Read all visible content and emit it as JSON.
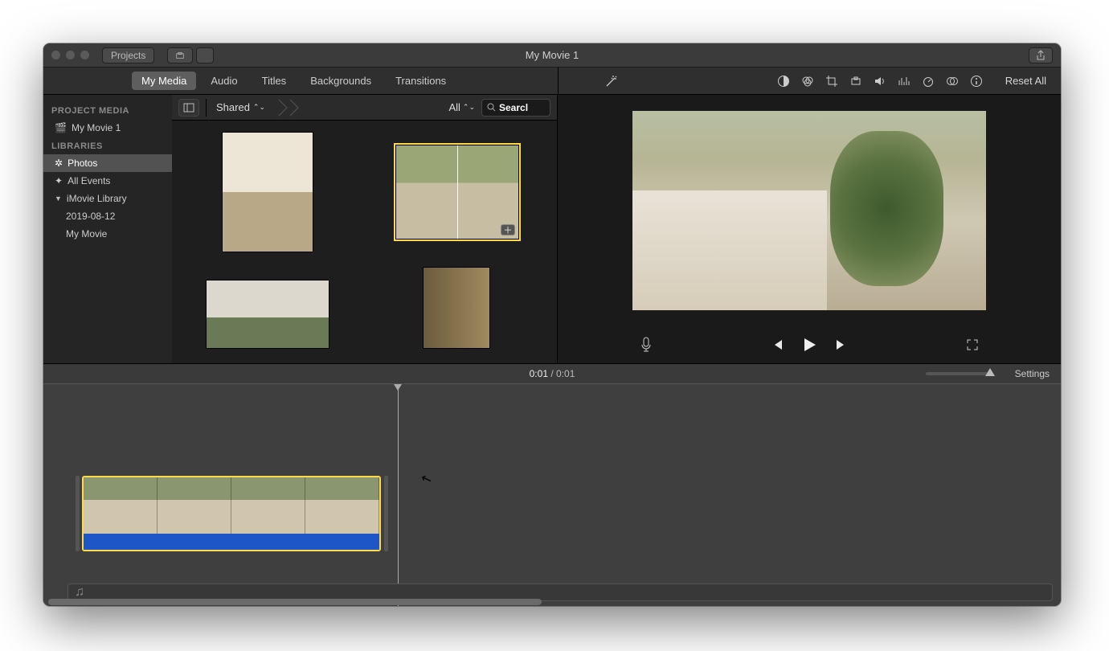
{
  "window_title": "My Movie 1",
  "toolbar": {
    "projects": "Projects"
  },
  "tabs": {
    "my_media": "My Media",
    "audio": "Audio",
    "titles": "Titles",
    "backgrounds": "Backgrounds",
    "transitions": "Transitions"
  },
  "viewer_controls": {
    "reset_all": "Reset All"
  },
  "sidebar": {
    "project_media_hdr": "PROJECT MEDIA",
    "movie_name": "My Movie 1",
    "libraries_hdr": "LIBRARIES",
    "photos": "Photos",
    "all_events": "All Events",
    "imovie_library": "iMovie Library",
    "event_date": "2019-08-12",
    "event_my_movie": "My Movie"
  },
  "browser": {
    "shared": "Shared",
    "all": "All",
    "search_placeholder": "Search",
    "search_value": "Searcl"
  },
  "time": {
    "current": "0:01",
    "separator": " / ",
    "total": "0:01",
    "settings": "Settings"
  }
}
